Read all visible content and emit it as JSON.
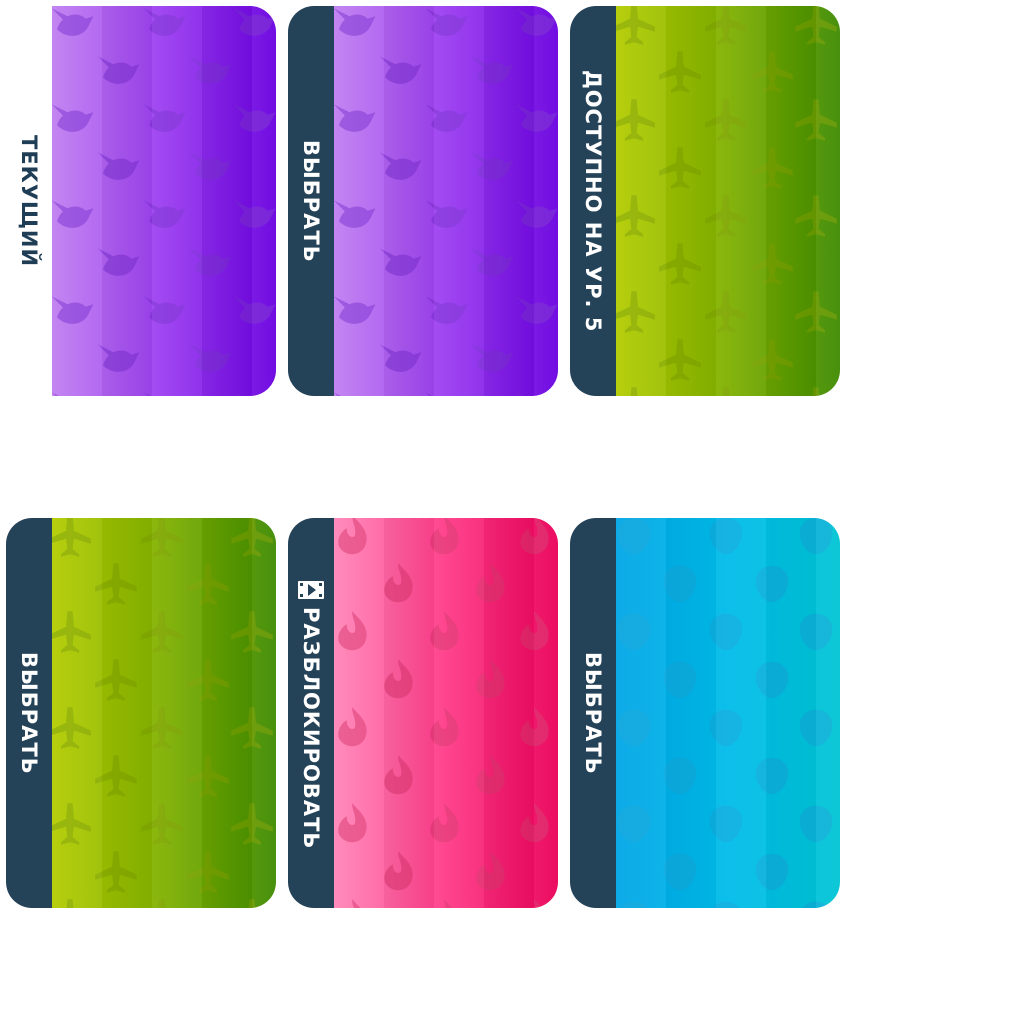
{
  "cards": [
    {
      "id": "purple-1",
      "label": "ТЕКУЩИЙ",
      "state": "current",
      "gradient": [
        "#c07ff0",
        "#9a3cf0",
        "#6a00e0"
      ],
      "pattern": "dove-icon",
      "patternColor": "#7a30d0"
    },
    {
      "id": "purple-2",
      "label": "ВЫБРАТЬ",
      "state": "select",
      "gradient": [
        "#c07ff0",
        "#9a3cf0",
        "#6a00e0"
      ],
      "pattern": "dove-icon",
      "patternColor": "#7a30d0"
    },
    {
      "id": "green-1",
      "label": "ДОСТУПНО НА УР. 5",
      "state": "locked",
      "gradient": [
        "#b3cc00",
        "#7fb000",
        "#3e8a00"
      ],
      "pattern": "airplane-icon",
      "patternColor": "#7ea000"
    },
    {
      "id": "green-2",
      "label": "ВЫБРАТЬ",
      "state": "select",
      "gradient": [
        "#b3cc00",
        "#7fb000",
        "#3e8a00"
      ],
      "pattern": "airplane-icon",
      "patternColor": "#7ea000"
    },
    {
      "id": "pink",
      "label": "РАЗБЛОКИРОВАТЬ",
      "state": "video-unlock",
      "icon": "video-play-icon",
      "gradient": [
        "#ff86b8",
        "#ff3a88",
        "#ea0058"
      ],
      "pattern": "flame-icon",
      "patternColor": "#d8356e"
    },
    {
      "id": "blue",
      "label": "ВЫБРАТЬ",
      "state": "select",
      "gradient": [
        "#00a6e6",
        "#00bcea",
        "#00c4d4"
      ],
      "pattern": "balloon-icon",
      "patternColor": "#12a6d8"
    }
  ]
}
